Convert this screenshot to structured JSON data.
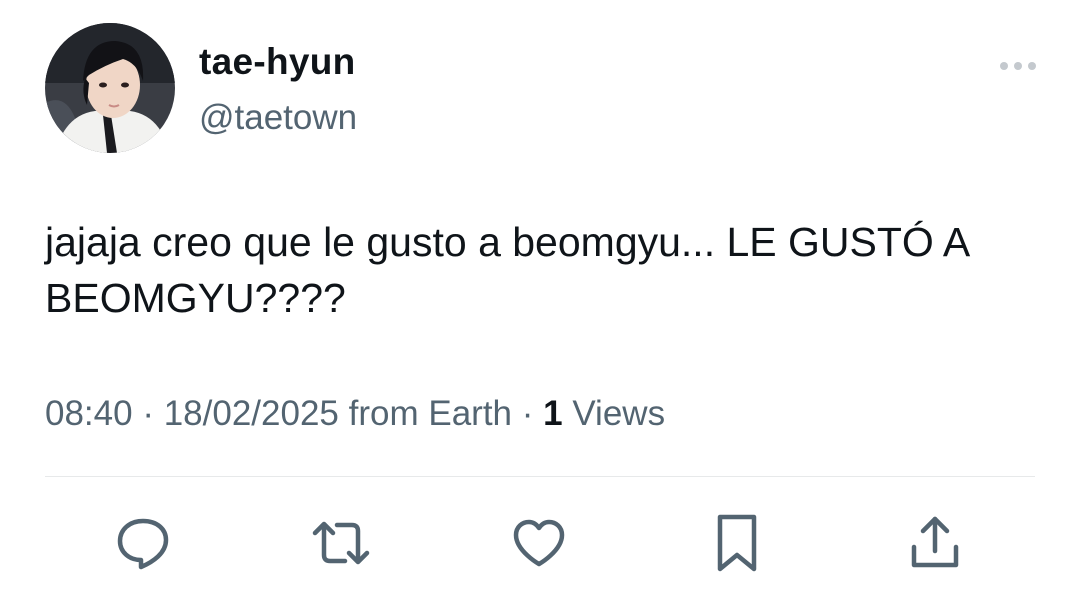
{
  "tweet": {
    "display_name": "tae-hyun",
    "handle": "@taetown",
    "text": "jajaja creo que le gusto a beomgyu... LE GUSTÓ A BEOMGYU????",
    "time": "08:40",
    "separator": "·",
    "date": "18/02/2025",
    "source": "from Earth",
    "views_count": "1",
    "views_label": "Views"
  },
  "icons": {
    "more": "more-horizontal-icon",
    "reply": "reply-icon",
    "retweet": "retweet-icon",
    "like": "like-icon",
    "bookmark": "bookmark-icon",
    "share": "share-icon"
  },
  "colors": {
    "text_primary": "#0f1419",
    "text_secondary": "#536471",
    "icon_gray": "#536471",
    "divider": "#e7e9ea"
  }
}
